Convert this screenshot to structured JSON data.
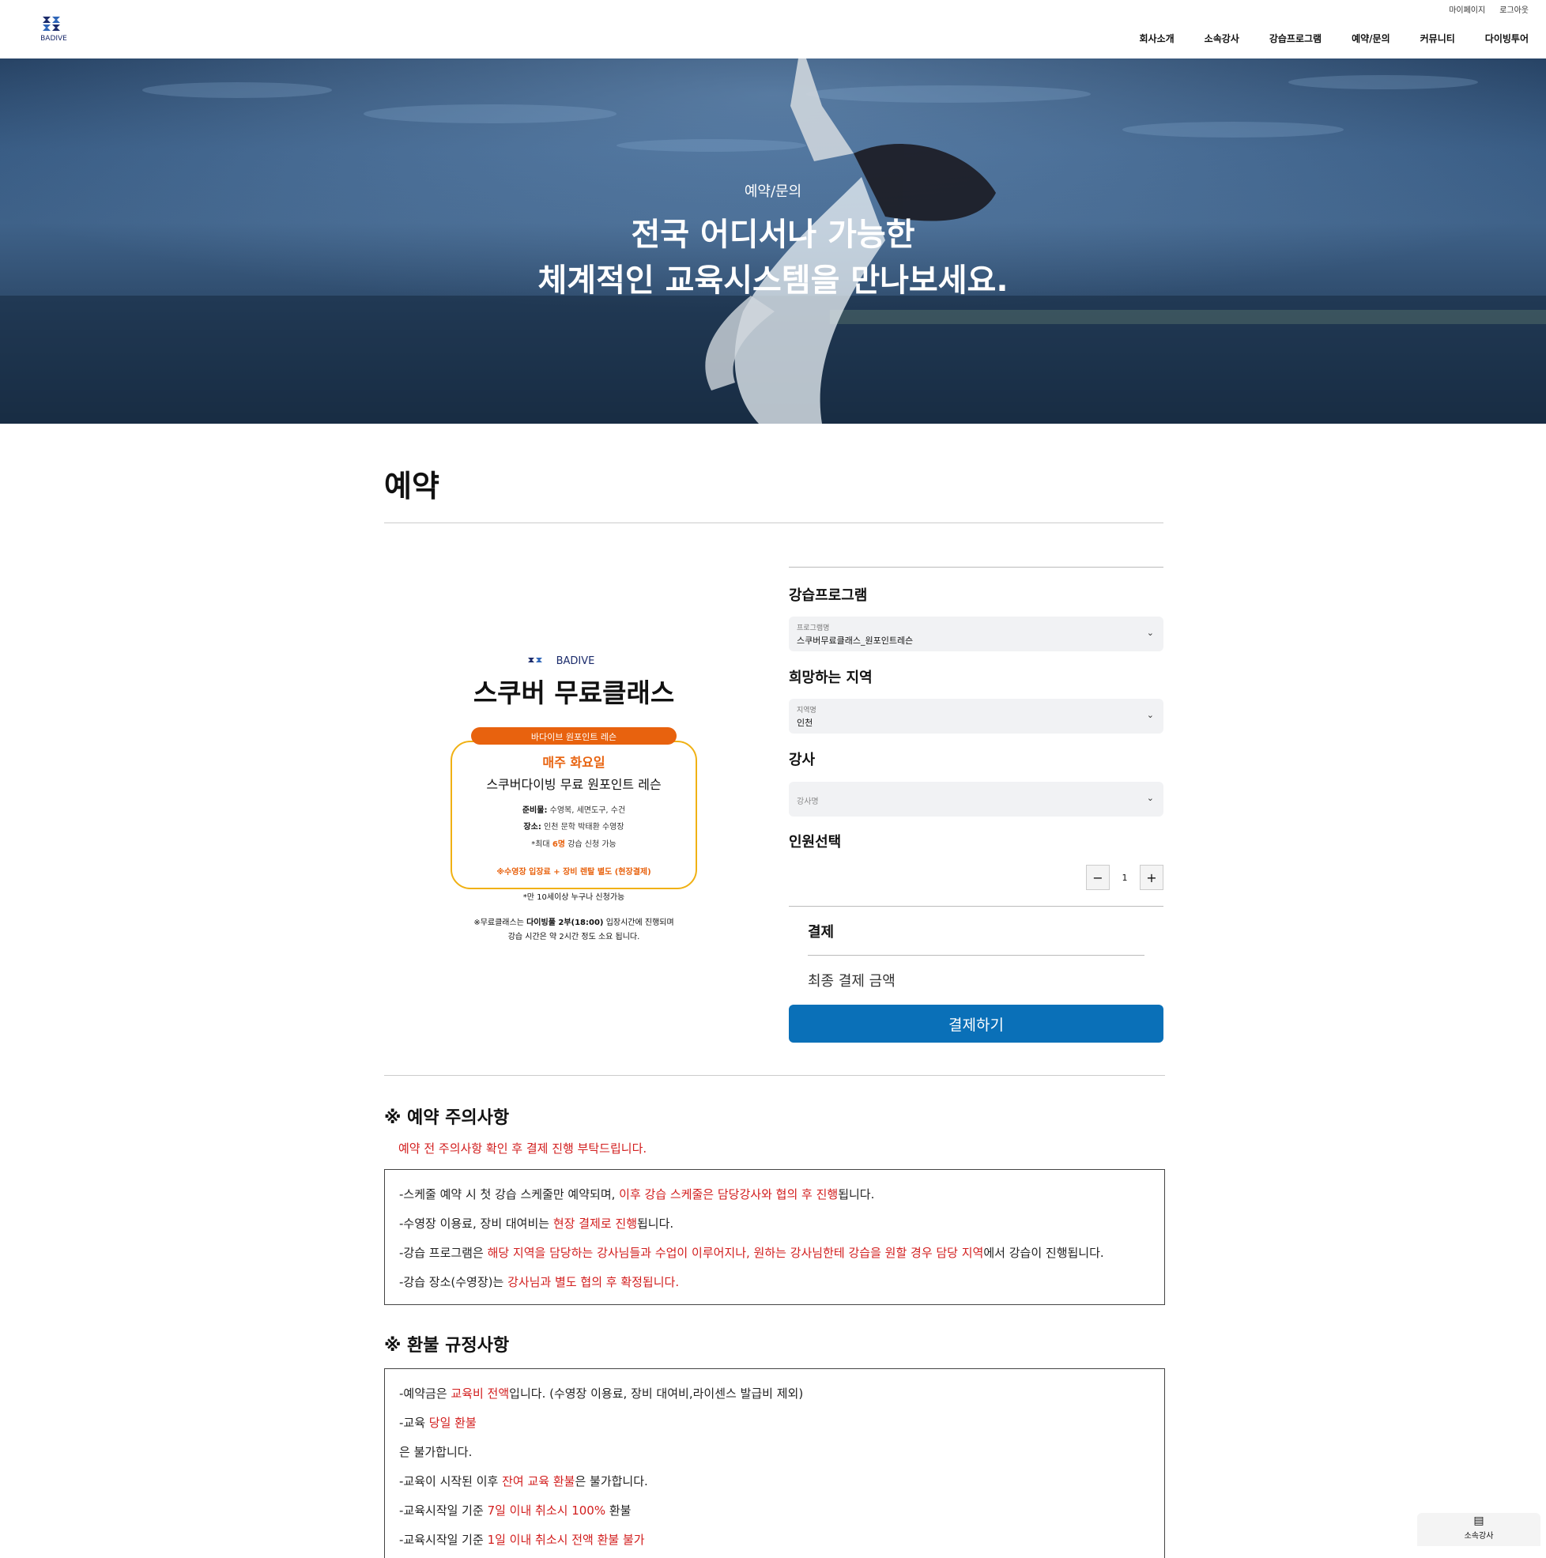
{
  "header": {
    "brand": "BADIVE",
    "util": [
      "마이페이지",
      "로그아웃"
    ],
    "nav": [
      "회사소개",
      "소속강사",
      "강습프로그램",
      "예약/문의",
      "커뮤니티",
      "다이빙투어"
    ]
  },
  "hero": {
    "subtitle": "예약/문의",
    "title_line1": "전국 어디서나 가능한",
    "title_line2": "체계적인 교육시스템을 만나보세요."
  },
  "page_title": "예약",
  "poster": {
    "brand": "BADIVE",
    "title": "스쿠버 무료클래스",
    "badge": "바다이브 원포인트 레슨",
    "day": "매주 화요일",
    "subtitle": "스쿠버다이빙 무료 원포인트 레슨",
    "prep_label": "준비물:",
    "prep": "수영복, 세면도구, 수건",
    "place_label": "장소:",
    "place": "인천 문학 박태환 수영장",
    "max_prefix": "*최대",
    "max_count": "6명",
    "max_suffix": "강습 신청 가능",
    "fee_note": "※수영장 입장료 + 장비 렌탈 별도 (현장결제)",
    "age_note": "*만 10세이상 누구나 신청가능",
    "foot1_prefix": "※무료클래스는",
    "foot1_bold": "다이빙풀 2부(18:00)",
    "foot1_suffix": "입장시간에 진행되며",
    "foot2": "강습 시간은 약 2시간 정도 소요 됩니다."
  },
  "form": {
    "program_label": "강습프로그램",
    "program_caption": "프로그램명",
    "program_value": "스쿠버무료클래스_원포인트레슨",
    "region_label": "희망하는 지역",
    "region_caption": "지역명",
    "region_value": "인천",
    "instructor_label": "강사",
    "instructor_placeholder": "강사명",
    "people_label": "인원선택",
    "quantity": "1",
    "payment_label": "결제",
    "final_amount_label": "최종 결제 금액",
    "pay_button": "결제하기"
  },
  "notice": {
    "title": "※ 예약 주의사항",
    "subtitle": "예약 전 주의사항 확인 후 결제 진행 부탁드립니다.",
    "l1a": "-스케줄 예약 시 첫 강습 스케줄만 예약되며, ",
    "l1b": "이후 강습 스케줄은 담당강사와 협의 후 진행",
    "l1c": "됩니다.",
    "l2a": "-수영장 이용료, 장비 대여비는 ",
    "l2b": "현장 결제로 진행",
    "l2c": "됩니다.",
    "l3a": "-강습 프로그램은 ",
    "l3b": "해당 지역을 담당하는 강사님들과 수업이 이루어지나, 원하는 강사님한테 강습을 원할 경우 담당 지역",
    "l3c": "에서 강습이 진행됩니다.",
    "l4a": "-강습 장소(수영장)는 ",
    "l4b": "강사님과 별도 협의 후 확정됩니다."
  },
  "refund": {
    "title": "※ 환불 규정사항",
    "l1a": "-예약금은 ",
    "l1b": "교육비 전액",
    "l1c": "입니다. (수영장 이용료, 장비 대여비,라이센스 발급비 제외)",
    "l2a": "-교육 ",
    "l2b": "당일 환불",
    "l3": "은 불가합니다.",
    "l4a": "-교육이 시작된 이후 ",
    "l4b": "잔여 교육 환불",
    "l4c": "은 불가합니다.",
    "l5a": "-교육시작일 기준 ",
    "l5b": "7일 이내 취소시 100%",
    "l5c": " 환불",
    "l6a": "-교육시작일 기준 ",
    "l6b": "1일 이내 취소시 전액 환불 불가"
  },
  "floating": {
    "label": "소속강사"
  },
  "colors": {
    "primary": "#0a70b8",
    "accent_red": "#d21d1d",
    "poster_orange": "#e8620e",
    "poster_border": "#f0b114"
  }
}
